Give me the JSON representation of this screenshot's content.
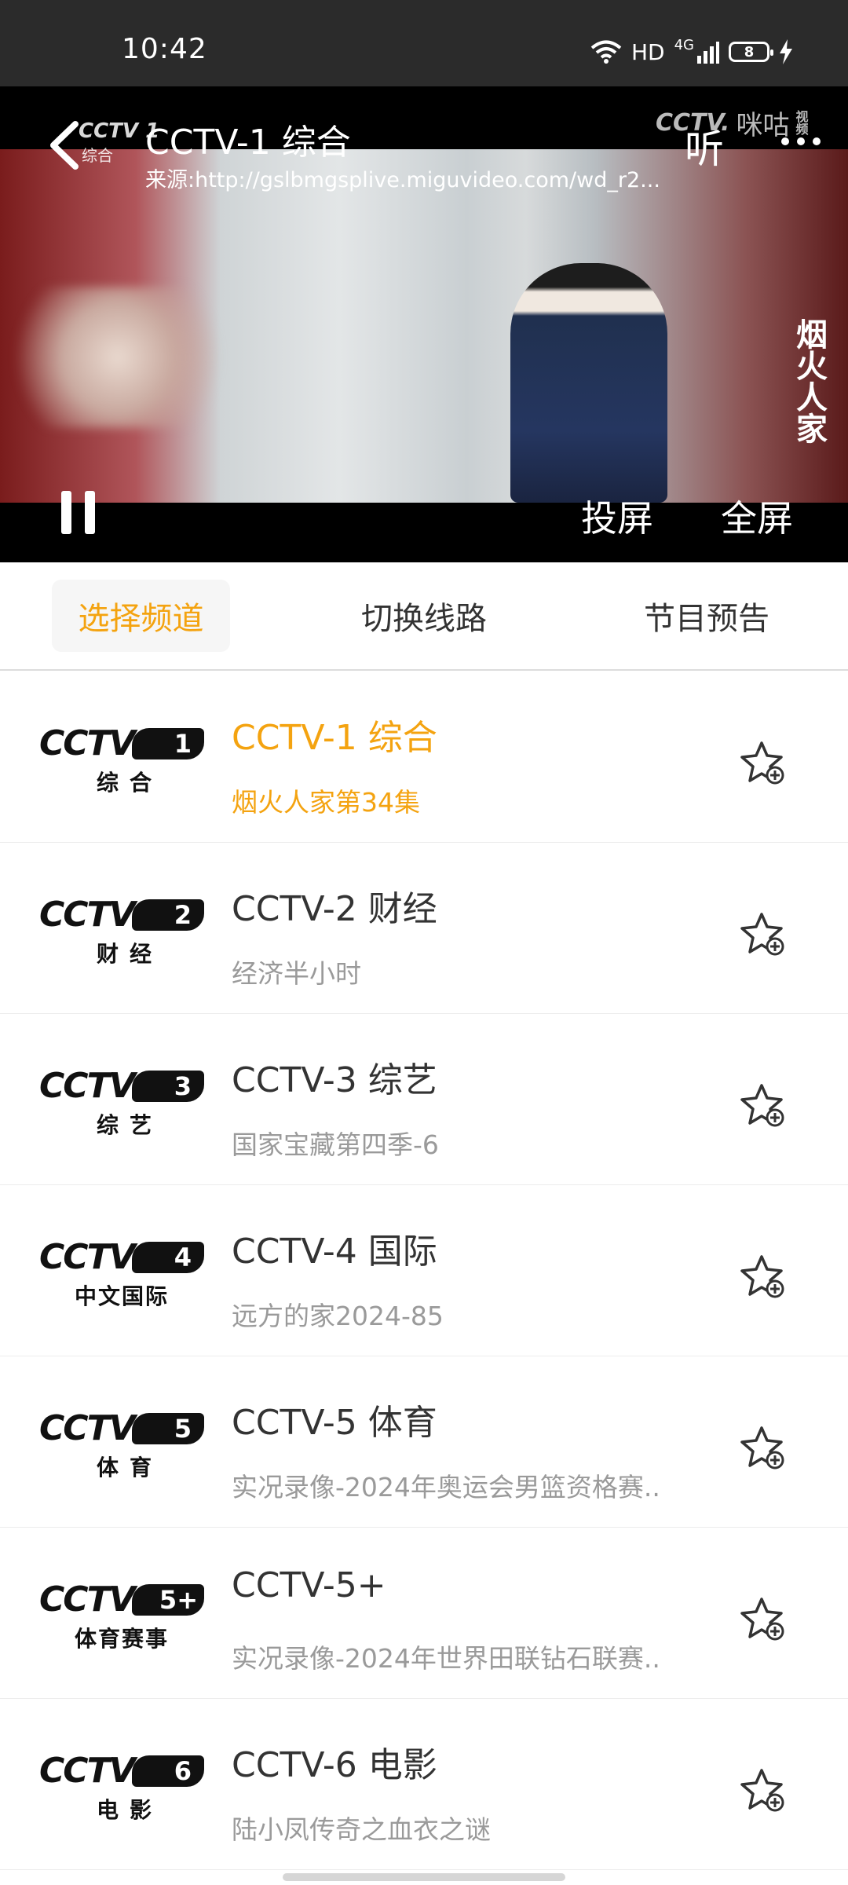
{
  "status": {
    "time": "10:42",
    "hd": "HD",
    "network": "4G",
    "battery": "8"
  },
  "player": {
    "logo_text": "CCTV 1",
    "logo_sub": "综合",
    "title": "CCTV-1 综合",
    "source": "来源:http://gslbmgsplive.miguvideo.com/wd_r2...",
    "listen_label": "听",
    "watermark_a": "CCTV.",
    "watermark_b": "咪咕",
    "watermark_c": "视频",
    "show_title": "烟火人家",
    "cast_label": "投屏",
    "fullscreen_label": "全屏"
  },
  "tabs": [
    {
      "label": "选择频道",
      "active": true
    },
    {
      "label": "切换线路",
      "active": false
    },
    {
      "label": "节目预告",
      "active": false
    }
  ],
  "channels": [
    {
      "logo_text": "CCTV",
      "badge": "1",
      "sub": "综合",
      "name": "CCTV-1 综合",
      "program": "烟火人家第34集",
      "active": true
    },
    {
      "logo_text": "CCTV",
      "badge": "2",
      "sub": "财经",
      "name": "CCTV-2 财经",
      "program": "经济半小时",
      "active": false
    },
    {
      "logo_text": "CCTV",
      "badge": "3",
      "sub": "综艺",
      "name": "CCTV-3 综艺",
      "program": "国家宝藏第四季-6",
      "active": false
    },
    {
      "logo_text": "CCTV",
      "badge": "4",
      "sub": "中文国际",
      "name": "CCTV-4 国际",
      "program": "远方的家2024-85",
      "active": false
    },
    {
      "logo_text": "CCTV",
      "badge": "5",
      "sub": "体育",
      "name": "CCTV-5 体育",
      "program": "实况录像-2024年奥运会男篮资格赛..",
      "active": false
    },
    {
      "logo_text": "CCTV",
      "badge": "5+",
      "sub": "体育赛事",
      "name": "CCTV-5+",
      "program": "实况录像-2024年世界田联钻石联赛..",
      "active": false
    },
    {
      "logo_text": "CCTV",
      "badge": "6",
      "sub": "电影",
      "name": "CCTV-6 电影",
      "program": "陆小凤传奇之血衣之谜",
      "active": false
    }
  ],
  "colors": {
    "accent": "#f4a310",
    "status_bar": "#2b2b2b",
    "muted_text": "#9a9a9a"
  },
  "icons": {
    "back": "back-arrow-icon",
    "more": "more-dots-icon",
    "pause": "pause-icon",
    "favorite": "star-add-icon",
    "wifi": "wifi-icon",
    "signal": "signal-icon",
    "charging": "charging-bolt-icon"
  }
}
